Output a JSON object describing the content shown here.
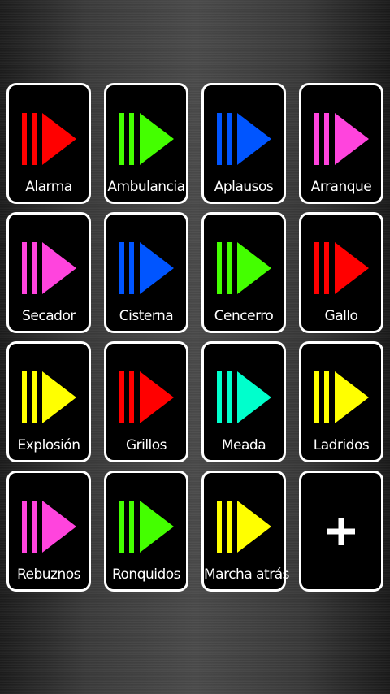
{
  "sounds": [
    {
      "label": "Alarma",
      "color": "#ff0000"
    },
    {
      "label": "Ambulancia",
      "color": "#44ff00"
    },
    {
      "label": "Aplausos",
      "color": "#0055ff"
    },
    {
      "label": "Arranque",
      "color": "#ff44dd"
    },
    {
      "label": "Secador",
      "color": "#ff44dd"
    },
    {
      "label": "Cisterna",
      "color": "#0055ff"
    },
    {
      "label": "Cencerro",
      "color": "#44ff00"
    },
    {
      "label": "Gallo",
      "color": "#ff0000"
    },
    {
      "label": "Explosión",
      "color": "#ffff00"
    },
    {
      "label": "Grillos",
      "color": "#ff0000"
    },
    {
      "label": "Meada",
      "color": "#00ffcc"
    },
    {
      "label": "Ladridos",
      "color": "#ffff00"
    },
    {
      "label": "Rebuznos",
      "color": "#ff44dd"
    },
    {
      "label": "Ronquidos",
      "color": "#44ff00"
    },
    {
      "label": "Marcha atrás",
      "color": "#ffff00"
    }
  ],
  "add_button": {
    "icon": "plus-icon",
    "color": "#ffffff"
  },
  "tile": {
    "background": "#000000",
    "border_color": "#ffffff"
  }
}
